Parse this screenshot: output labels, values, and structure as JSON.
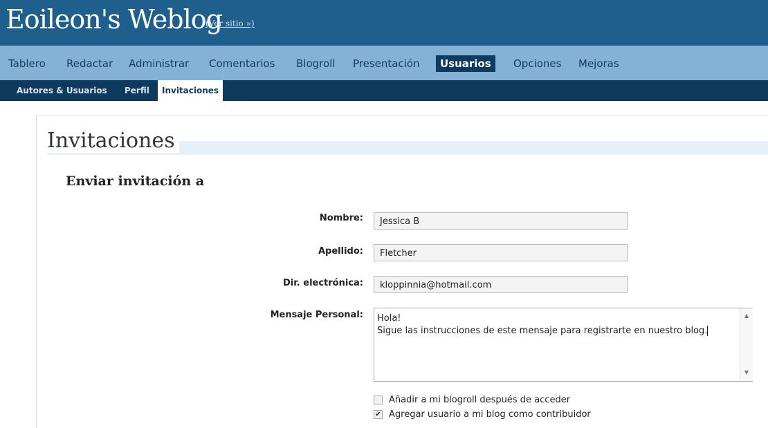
{
  "header": {
    "site_title": "Eoileon's Weblog",
    "view_site": "(Ver sitio »)"
  },
  "mainnav": {
    "items": [
      {
        "label": "Tablero"
      },
      {
        "label": "Redactar"
      },
      {
        "label": "Administrar"
      },
      {
        "label": "Comentarios"
      },
      {
        "label": "Blogroll"
      },
      {
        "label": "Presentación"
      },
      {
        "label": "Usuarios"
      },
      {
        "label": "Opciones"
      },
      {
        "label": "Mejoras"
      }
    ],
    "active": "Usuarios"
  },
  "subnav": {
    "items": [
      {
        "label": "Autores & Usuarios"
      },
      {
        "label": "Perfil"
      },
      {
        "label": "Invitaciones"
      }
    ],
    "active": "Invitaciones"
  },
  "page": {
    "title": "Invitaciones",
    "section_title": "Enviar invitación a"
  },
  "form": {
    "first_name_label": "Nombre:",
    "first_name_value": "Jessica B",
    "last_name_label": "Apellido:",
    "last_name_value": "Fletcher",
    "email_label": "Dir. electrónica:",
    "email_value": "kloppinnia@hotmail.com",
    "message_label": "Mensaje Personal:",
    "message_value": "Hola!\nSigue las instrucciones de este mensaje para registrarte en nuestro blog.",
    "option_blogroll_label": "Añadir a mi blogroll después de acceder",
    "option_blogroll_checked": false,
    "option_contributor_label": "Agregar usuario a mi blog como contribuidor",
    "option_contributor_checked": true
  },
  "icons": {
    "check": "✔",
    "scroll_up": "▲",
    "scroll_down": "▼"
  },
  "colors": {
    "header_bg": "#1f5f8e",
    "nav_bg": "#84b1d6",
    "subnav_bg": "#0e3a5e"
  }
}
